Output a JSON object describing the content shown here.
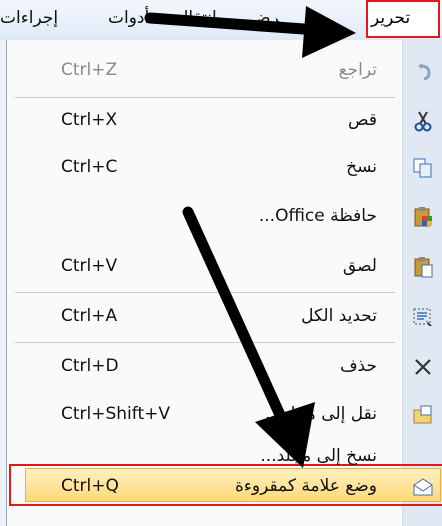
{
  "menubar": {
    "actions": "إجراءات",
    "tools": "أدوات",
    "go": "انتقال",
    "view": "عرض",
    "edit": "تحرير"
  },
  "menu": {
    "items": [
      {
        "label": "تراجع",
        "shortcut": "Ctrl+Z",
        "icon": "undo-icon",
        "disabled": true
      },
      {
        "label": "قص",
        "shortcut": "Ctrl+X",
        "icon": "cut-icon",
        "disabled": false
      },
      {
        "label": "نسخ",
        "shortcut": "Ctrl+C",
        "icon": "copy-icon",
        "disabled": false
      },
      {
        "label": "حافظة Office...",
        "shortcut": "",
        "icon": "office-clipboard-icon",
        "disabled": false
      },
      {
        "label": "لصق",
        "shortcut": "Ctrl+V",
        "icon": "paste-icon",
        "disabled": false
      },
      {
        "label": "تحديد الكل",
        "shortcut": "Ctrl+A",
        "icon": "select-all-icon",
        "disabled": false
      },
      {
        "label": "حذف",
        "shortcut": "Ctrl+D",
        "icon": "delete-icon",
        "disabled": false
      },
      {
        "label": "نقل إلى مجلد...",
        "shortcut": "Ctrl+Shift+V",
        "icon": "move-to-folder-icon",
        "disabled": false
      },
      {
        "label": "نسخ إلى مجلد...",
        "shortcut": "",
        "icon": "",
        "disabled": false
      },
      {
        "label": "وضع علامة كمقروءة",
        "shortcut": "Ctrl+Q",
        "icon": "mark-as-read-icon",
        "disabled": false
      }
    ]
  },
  "colors": {
    "highlight_border": "#e01818",
    "hover_fill": "#ffd97a",
    "gutter": "#dfe8f3"
  }
}
